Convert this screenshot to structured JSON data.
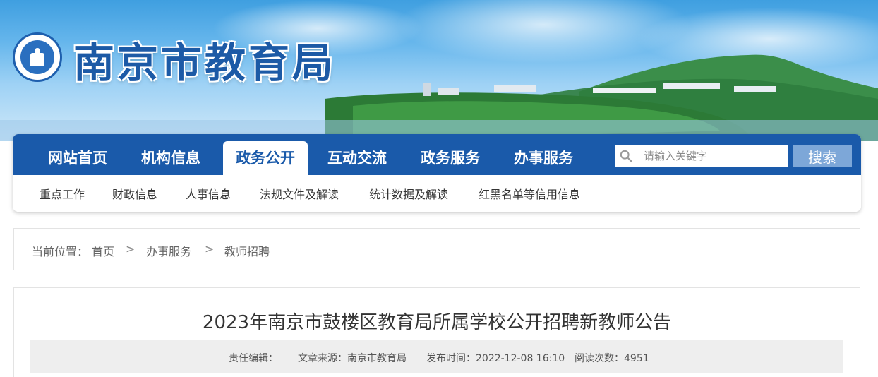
{
  "header": {
    "site_title": "南京市教育局"
  },
  "nav": {
    "items": [
      {
        "label": "网站首页"
      },
      {
        "label": "机构信息"
      },
      {
        "label": "政务公开",
        "active": true
      },
      {
        "label": "互动交流"
      },
      {
        "label": "政务服务"
      },
      {
        "label": "办事服务"
      }
    ],
    "search_placeholder": "请输入关键字",
    "search_button": "搜索"
  },
  "sub_nav": {
    "items": [
      {
        "label": "重点工作"
      },
      {
        "label": "财政信息"
      },
      {
        "label": "人事信息"
      },
      {
        "label": "法规文件及解读"
      },
      {
        "label": "统计数据及解读"
      },
      {
        "label": "红黑名单等信用信息"
      }
    ]
  },
  "breadcrumb": {
    "prefix": "当前位置：",
    "items": [
      "首页",
      "办事服务",
      "教师招聘"
    ],
    "separator": ">"
  },
  "article": {
    "title": "2023年南京市鼓楼区教育局所属学校公开招聘新教师公告",
    "editor_label": "责任编辑：",
    "source_label": "文章来源：南京市教育局",
    "publish_label": "发布时间：2022-12-08 16:10",
    "views_label": "阅读次数：4951"
  },
  "colors": {
    "nav_blue": "#1a5aaa",
    "search_button": "#7da7d8"
  }
}
